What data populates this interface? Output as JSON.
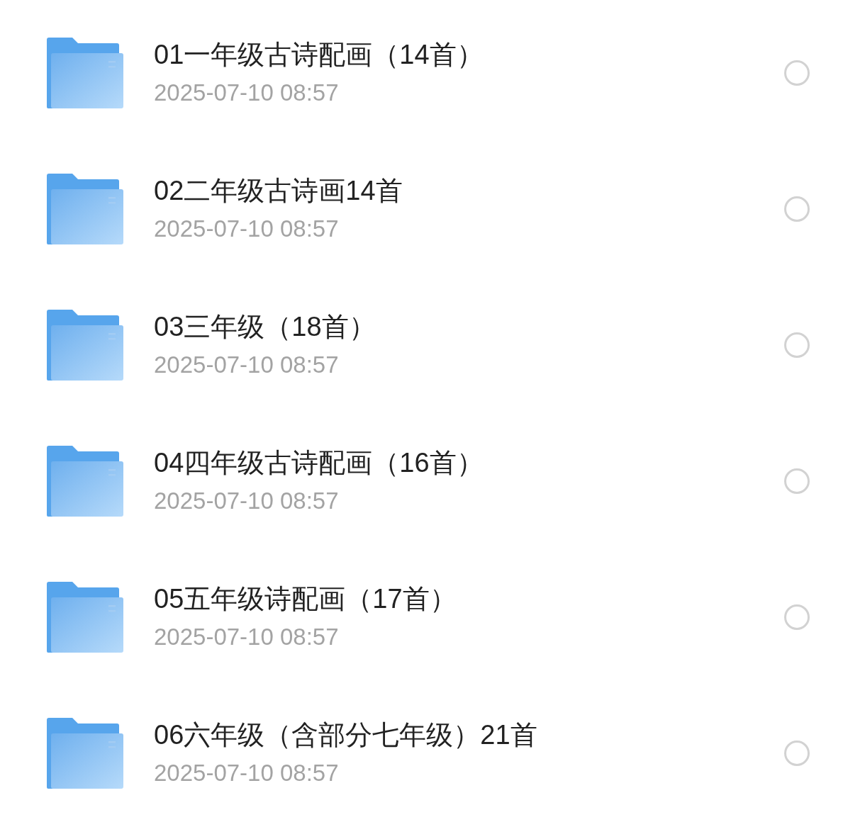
{
  "items": [
    {
      "name": "01一年级古诗配画（14首）",
      "date": "2025-07-10 08:57",
      "selected": false
    },
    {
      "name": "02二年级古诗画14首",
      "date": "2025-07-10 08:57",
      "selected": false
    },
    {
      "name": "03三年级（18首）",
      "date": "2025-07-10 08:57",
      "selected": false
    },
    {
      "name": "04四年级古诗配画（16首）",
      "date": "2025-07-10 08:57",
      "selected": false
    },
    {
      "name": "05五年级诗配画（17首）",
      "date": "2025-07-10 08:57",
      "selected": false
    },
    {
      "name": "06六年级（含部分七年级）21首",
      "date": "2025-07-10 08:57",
      "selected": false
    }
  ]
}
